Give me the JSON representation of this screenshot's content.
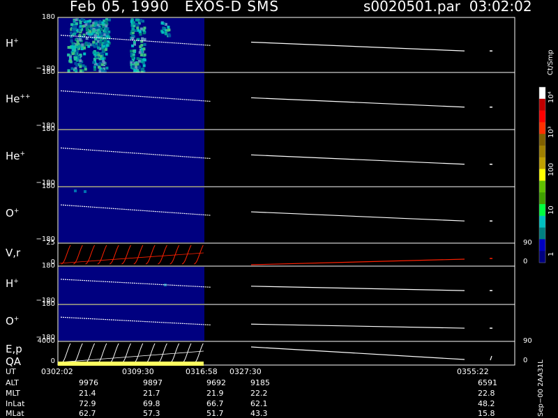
{
  "header": {
    "date": "Feb 05, 1990",
    "instrument": "EXOS-D SMS",
    "file": "s0020501.par",
    "time": "03:02:02"
  },
  "panels": [
    {
      "label_base": "H",
      "label_sup": "+",
      "ymax": "180",
      "ymin": "−180",
      "type": "spectrogram"
    },
    {
      "label_base": "He",
      "label_sup": "++",
      "ymax": "180",
      "ymin": "−180",
      "type": "spectrogram"
    },
    {
      "label_base": "He",
      "label_sup": "+",
      "ymax": "180",
      "ymin": "−180",
      "type": "spectrogram"
    },
    {
      "label_base": "O",
      "label_sup": "+",
      "ymax": "180",
      "ymin": "−180",
      "type": "spectrogram"
    },
    {
      "label_base": "V,r",
      "label_sup": "",
      "ymax": "25",
      "ymin": "0",
      "right_max": "90",
      "right_min": "0",
      "type": "line"
    },
    {
      "label_base": "H",
      "label_sup": "+",
      "ymax": "180",
      "ymin": "−180",
      "type": "spectrogram"
    },
    {
      "label_base": "O",
      "label_sup": "+",
      "ymax": "180",
      "ymin": "−180",
      "type": "spectrogram"
    },
    {
      "label_base": "E,p",
      "label_sup": "",
      "label2": "QA",
      "ymax": "4000",
      "ymin": "0",
      "right_max": "90",
      "right_min": "0",
      "type": "line"
    }
  ],
  "colorbar": {
    "unit": "Ct/Smp",
    "tick_labels": [
      "10⁴",
      "10³",
      "100",
      "10",
      "1"
    ],
    "colors": [
      "#ffffff",
      "#c00000",
      "#ff0000",
      "#ff3000",
      "#806000",
      "#a08000",
      "#c0a000",
      "#ffff00",
      "#60c000",
      "#40a000",
      "#00ff40",
      "#00c0c0",
      "#008080",
      "#0000c0",
      "#000080"
    ]
  },
  "footer": {
    "row_labels": [
      "UT",
      "ALT",
      "MLT",
      "InLat",
      "MLat"
    ],
    "columns": [
      {
        "UT": "0302:02",
        "ALT": "9976",
        "MLT": "21.4",
        "InLat": "72.9",
        "MLat": "62.7"
      },
      {
        "UT": "0309:30",
        "ALT": "9897",
        "MLT": "21.7",
        "InLat": "69.8",
        "MLat": "57.3"
      },
      {
        "UT": "0316:58",
        "ALT": "9692",
        "MLT": "21.9",
        "InLat": "66.7",
        "MLat": "51.7"
      },
      {
        "UT": "0327:30",
        "ALT": "9185",
        "MLT": "22.2",
        "InLat": "62.1",
        "MLat": "43.3"
      },
      {
        "UT": "0355:22",
        "ALT": "6591",
        "MLT": "22.8",
        "InLat": "48.2",
        "MLat": "15.8"
      }
    ],
    "stamp": "Sep−00 2AA31L"
  },
  "chart_data": {
    "type": "heatmap",
    "title": "Feb 05, 1990   EXOS-D SMS",
    "x": [
      "0302:02",
      "0309:30",
      "0316:58",
      "0327:30",
      "0355:22"
    ],
    "xlabel": "UT",
    "ylim": [
      -180,
      180
    ],
    "series": [
      {
        "name": "H+",
        "values": [
          80,
          55,
          30,
          10,
          -15
        ]
      },
      {
        "name": "He++",
        "values": [
          80,
          55,
          30,
          10,
          -15
        ]
      },
      {
        "name": "He+",
        "values": [
          80,
          55,
          30,
          10,
          -15
        ]
      },
      {
        "name": "O+",
        "values": [
          80,
          55,
          30,
          10,
          -15
        ]
      }
    ],
    "colorbar_ticks": [
      "1",
      "10",
      "100",
      "10³",
      "10⁴"
    ],
    "colorbar_unit": "Ct/Smp"
  }
}
